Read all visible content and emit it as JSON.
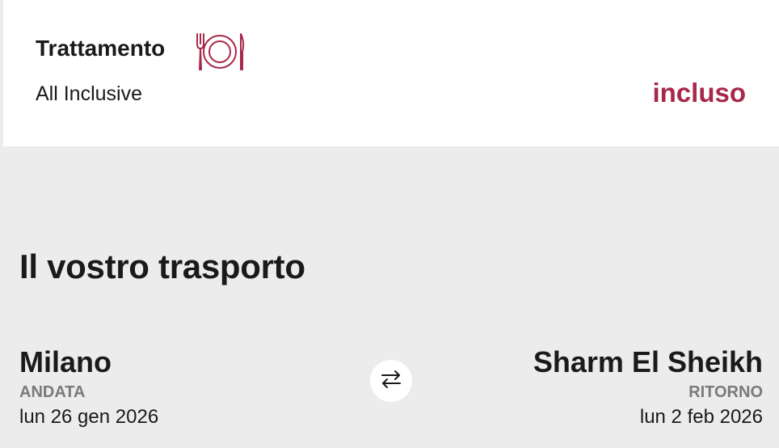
{
  "treatment": {
    "title": "Trattamento",
    "icon": "meal-plate-icon",
    "value": "All Inclusive",
    "price": "incluso",
    "accent_color": "#a8284b"
  },
  "transport": {
    "title": "Il vostro trasporto",
    "outbound": {
      "city": "Milano",
      "type": "ANDATA",
      "date": "lun 26 gen 2026"
    },
    "swap_icon": "swap-arrows-icon",
    "return": {
      "city": "Sharm El Sheikh",
      "type": "RITORNO",
      "date": "lun 2 feb 2026"
    }
  }
}
